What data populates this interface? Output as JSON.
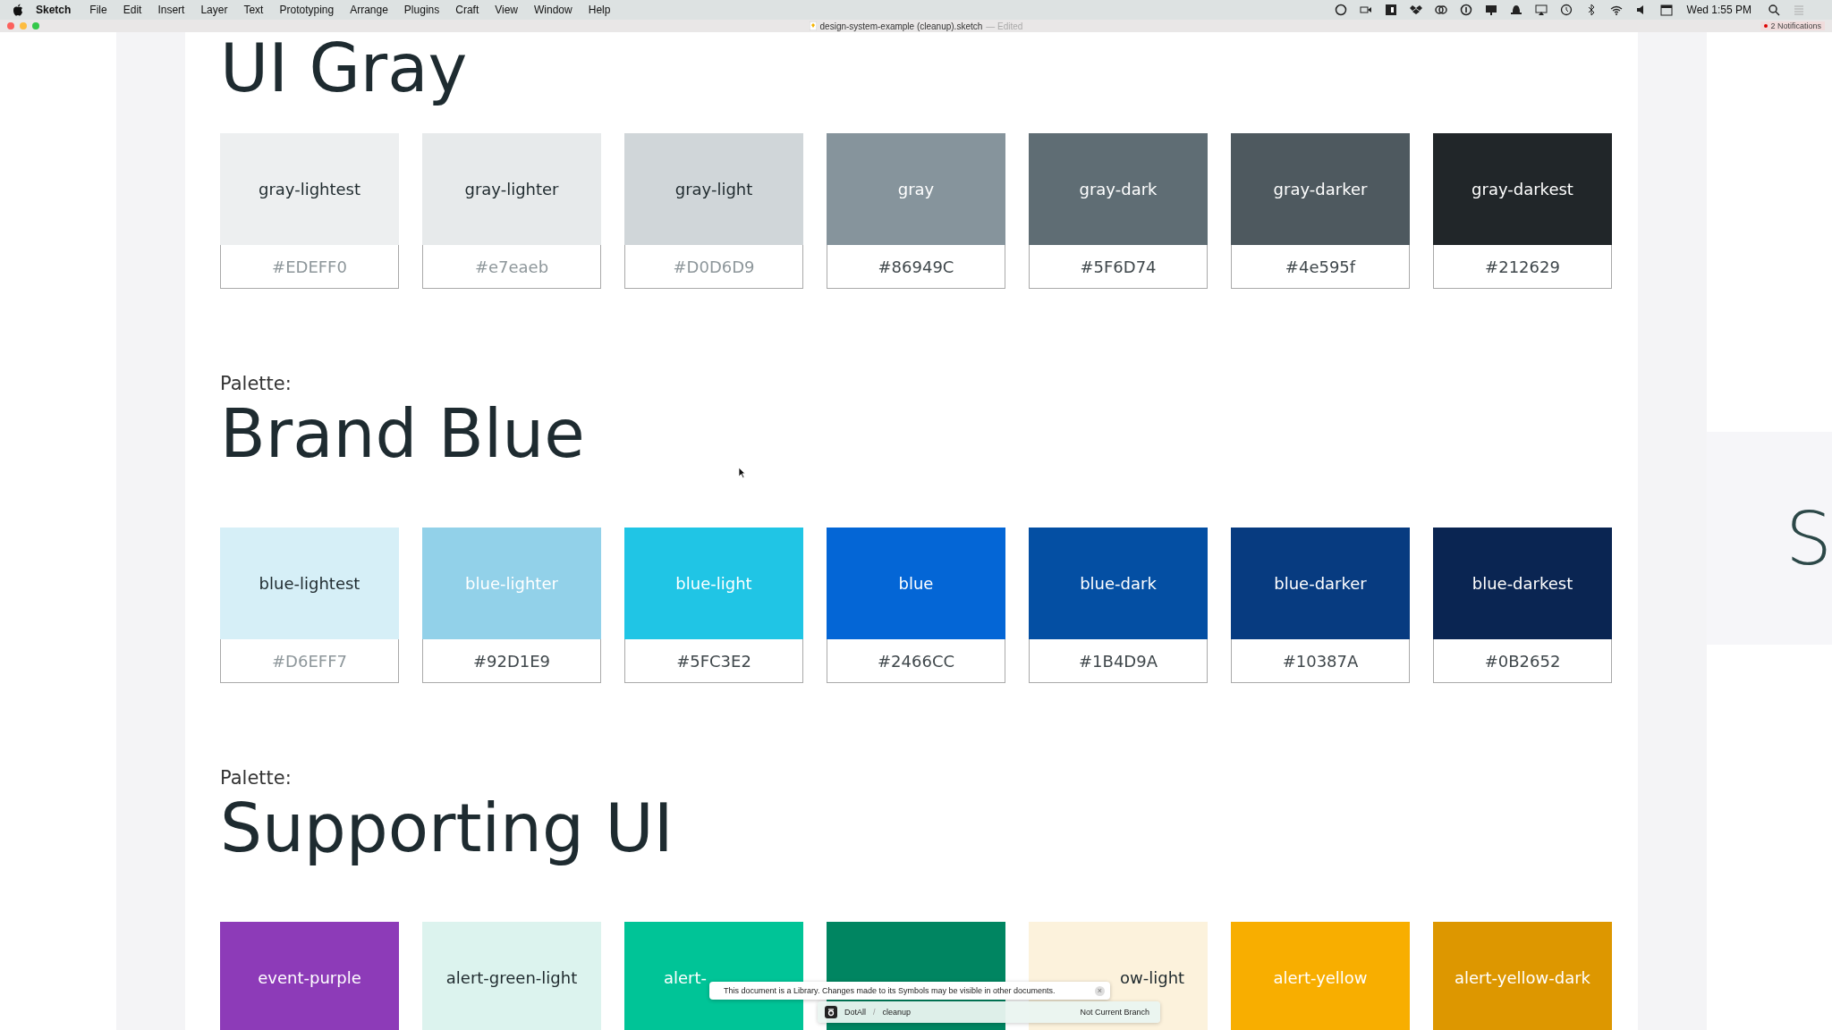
{
  "menu_bar": {
    "app": "Sketch",
    "items": [
      "File",
      "Edit",
      "Insert",
      "Layer",
      "Text",
      "Prototyping",
      "Arrange",
      "Plugins",
      "Craft",
      "View",
      "Window",
      "Help"
    ],
    "clock": "Wed 1:55 PM"
  },
  "window": {
    "title": "design-system-example (cleanup).sketch",
    "status": "— Edited",
    "notifications": "2 Notifications"
  },
  "sections": [
    {
      "heading": "UI Gray",
      "swatches": [
        {
          "name": "gray-lightest",
          "hex": "#EDEFF0",
          "color": "#edeff0"
        },
        {
          "name": "gray-lighter",
          "hex": "#e7eaeb",
          "color": "#e7eaeb"
        },
        {
          "name": "gray-light",
          "hex": "#D0D6D9",
          "color": "#d0d6d9"
        },
        {
          "name": "gray",
          "hex": "#86949C",
          "color": "#86949c"
        },
        {
          "name": "gray-dark",
          "hex": "#5F6D74",
          "color": "#5f6d74"
        },
        {
          "name": "gray-darker",
          "hex": "#4e595f",
          "color": "#4e595f"
        },
        {
          "name": "gray-darkest",
          "hex": "#212629",
          "color": "#212629"
        }
      ]
    },
    {
      "label": "Palette:",
      "heading": "Brand Blue",
      "swatches": [
        {
          "name": "blue-lightest",
          "hex": "#D6EFF7",
          "color": "#d6eff7"
        },
        {
          "name": "blue-lighter",
          "hex": "#92D1E9",
          "color": "#92d1e9"
        },
        {
          "name": "blue-light",
          "hex": "#5FC3E2",
          "color": "#20c5e5"
        },
        {
          "name": "blue",
          "hex": "#2466CC",
          "color": "#0466d6"
        },
        {
          "name": "blue-dark",
          "hex": "#1B4D9A",
          "color": "#044fa3"
        },
        {
          "name": "blue-darker",
          "hex": "#10387A",
          "color": "#073b80"
        },
        {
          "name": "blue-darkest",
          "hex": "#0B2652",
          "color": "#0a2552"
        }
      ]
    },
    {
      "label": "Palette:",
      "heading": "Supporting UI",
      "swatches": [
        {
          "name": "event-purple",
          "color": "#8d3bb8"
        },
        {
          "name": "alert-green-light",
          "color": "#dcf3ee"
        },
        {
          "name": "alert-",
          "color": "#00c497",
          "hidden_after": true
        },
        {
          "color": "#008561"
        },
        {
          "name": "ow-light",
          "color": "#fcf2dc",
          "hidden_before": true
        },
        {
          "name": "alert-yellow",
          "color": "#f8ae00"
        },
        {
          "name": "alert-yellow-dark",
          "color": "#dd9700"
        }
      ]
    }
  ],
  "side_artboard": {
    "heading": "S"
  },
  "toast": {
    "message": "This document is a Library. Changes made to its Symbols may be visible in other documents.",
    "close": "×"
  },
  "branch_bar": {
    "project": "DotAll",
    "separator": "/",
    "branch": "cleanup",
    "status": "Not Current Branch"
  }
}
